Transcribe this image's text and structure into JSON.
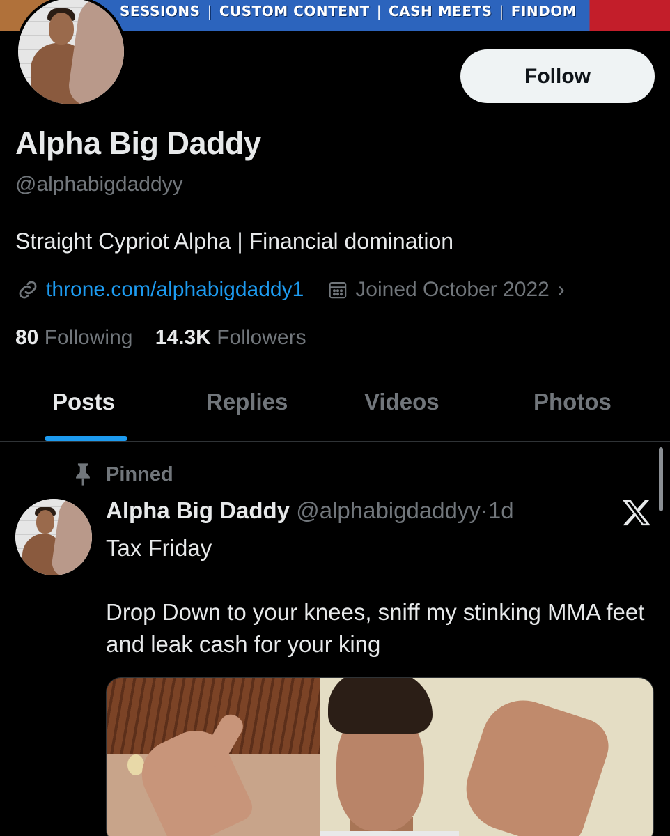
{
  "banner": {
    "items": [
      "SESSIONS",
      "CUSTOM CONTENT",
      "CASH MEETS",
      "FINDOM"
    ],
    "separator": "|"
  },
  "profile": {
    "follow_label": "Follow",
    "display_name": "Alpha Big Daddy",
    "handle": "@alphabigdaddyy",
    "bio": "Straight Cypriot Alpha | Financial domination",
    "link": "throne.com/alphabigdaddy1",
    "joined": "Joined October 2022",
    "following_count": "80",
    "following_label": "Following",
    "followers_count": "14.3K",
    "followers_label": "Followers"
  },
  "tabs": [
    {
      "label": "Posts",
      "active": true
    },
    {
      "label": "Replies",
      "active": false
    },
    {
      "label": "Videos",
      "active": false
    },
    {
      "label": "Photos",
      "active": false
    }
  ],
  "post": {
    "pinned_label": "Pinned",
    "author": "Alpha Big Daddy",
    "handle": "@alphabigdaddyy",
    "dot": "·",
    "time": "1d",
    "lines": [
      "Tax Friday",
      "Drop Down to your knees, sniff my stinking MMA feet and leak cash for your king"
    ]
  },
  "colors": {
    "accent": "#1d9bf0",
    "background": "#000000",
    "text_primary": "#e7e9ea",
    "text_secondary": "#71767b"
  },
  "icons": [
    "link-icon",
    "calendar-icon",
    "chevron-right-icon",
    "pin-icon",
    "x-logo-icon"
  ]
}
